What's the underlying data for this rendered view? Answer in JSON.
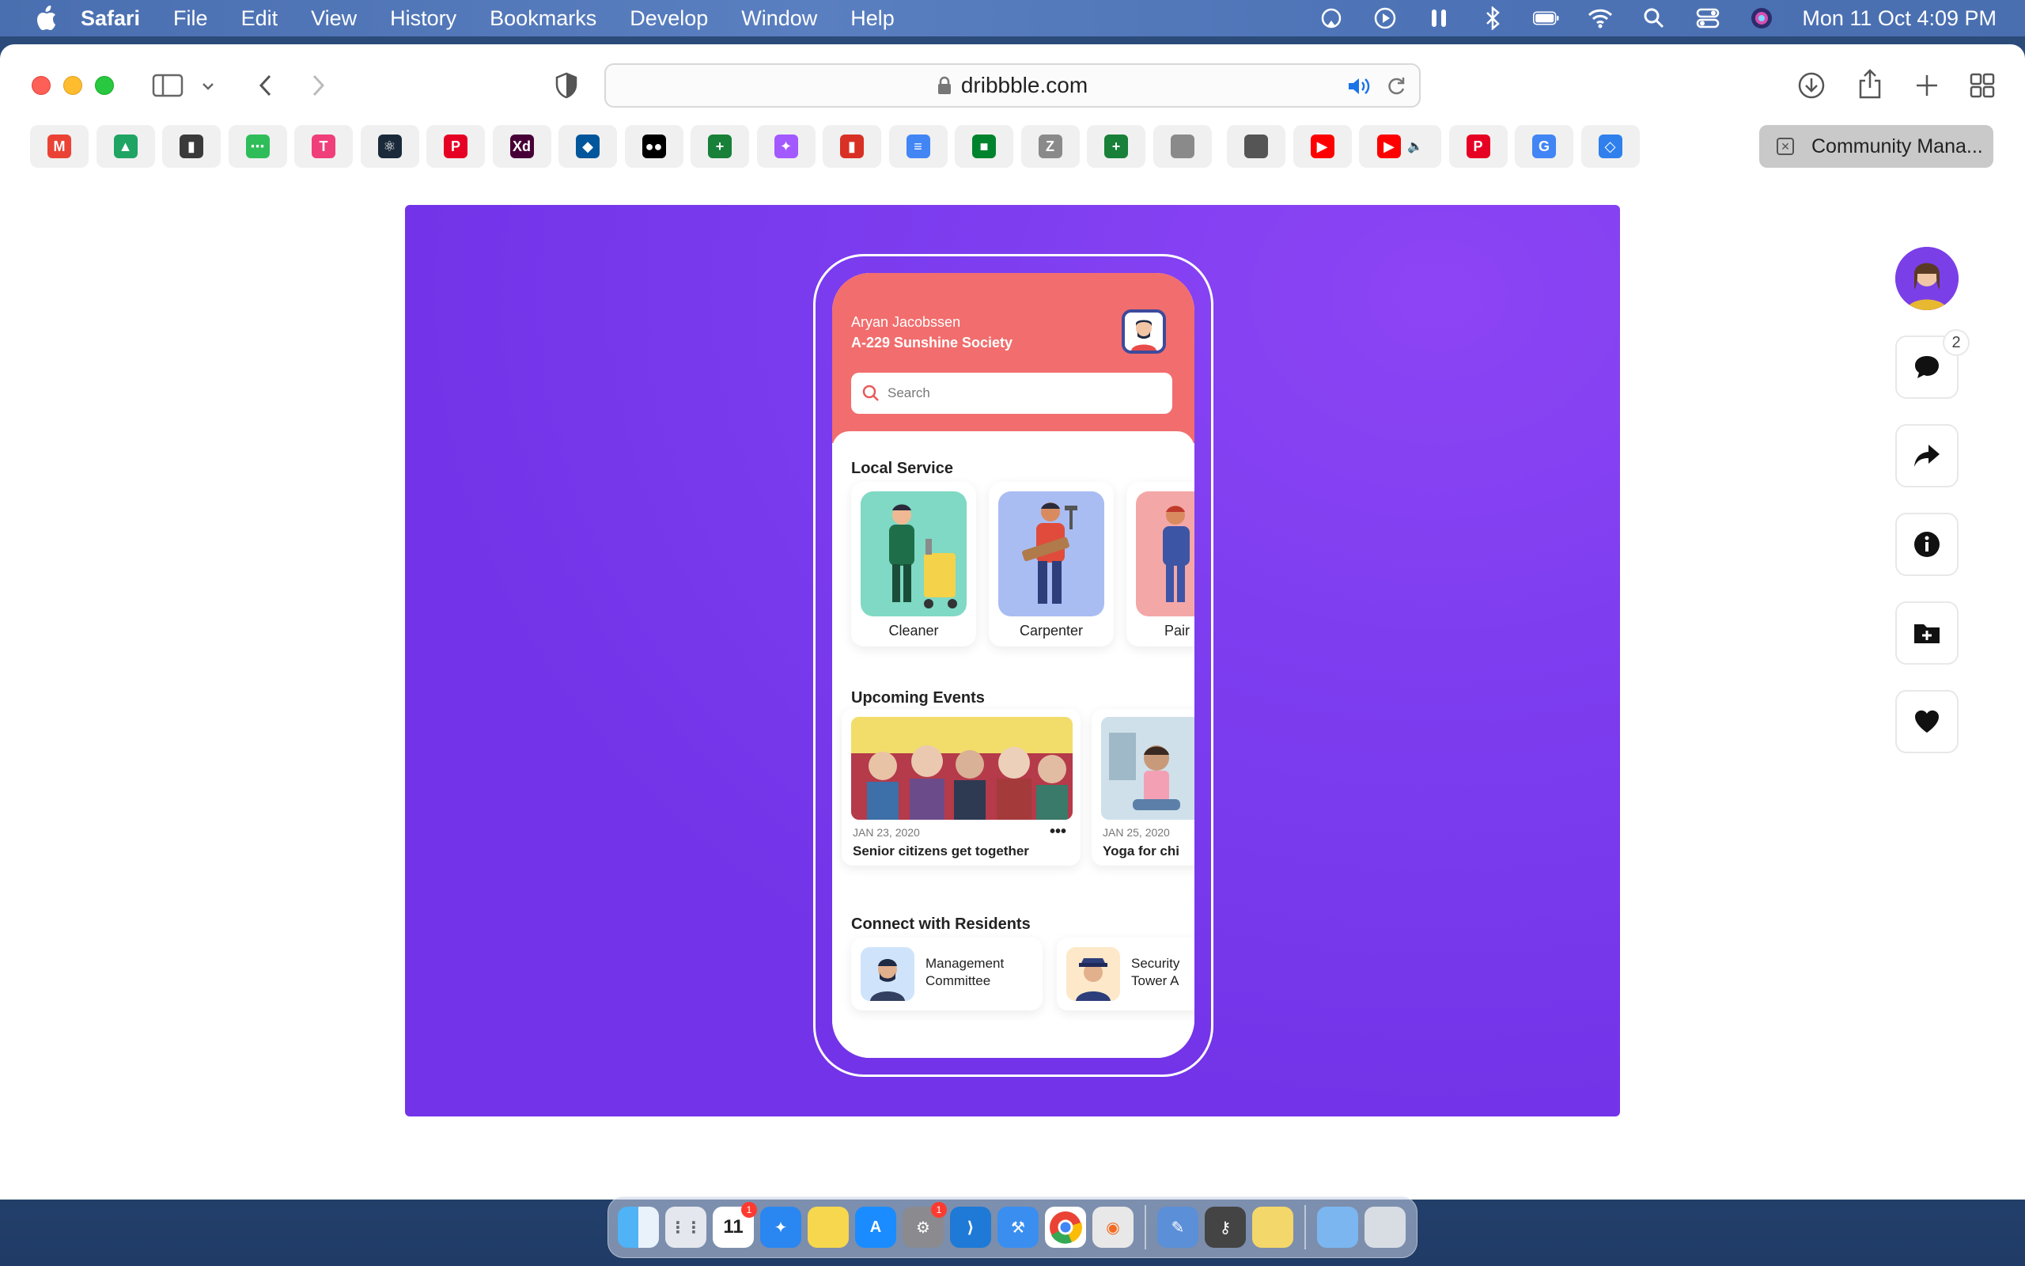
{
  "menubar": {
    "app_name": "Safari",
    "items": [
      "File",
      "Edit",
      "View",
      "History",
      "Bookmarks",
      "Develop",
      "Window",
      "Help"
    ],
    "clock": "Mon 11 Oct  4:09 PM"
  },
  "browser": {
    "url": "dribbble.com",
    "active_tab_title": "Community Mana...",
    "pinned_tabs": [
      {
        "icon": "gmail-icon",
        "glyph": "M",
        "color": "#ea4335"
      },
      {
        "icon": "google-drive-icon",
        "glyph": "▲",
        "color": "#1fa463"
      },
      {
        "icon": "sheets-icon",
        "glyph": "▮",
        "color": "#3a3a3a"
      },
      {
        "icon": "code-icon",
        "glyph": "⋯",
        "color": "#2ebd59"
      },
      {
        "icon": "t-icon",
        "glyph": "T",
        "color": "#ef3e7a"
      },
      {
        "icon": "react-icon",
        "glyph": "⚛",
        "color": "#1b2a3a"
      },
      {
        "icon": "pinterest-icon",
        "glyph": "P",
        "color": "#e60023"
      },
      {
        "icon": "adobe-xd-icon",
        "glyph": "Xd",
        "color": "#470137"
      },
      {
        "icon": "flutter-icon",
        "glyph": "◆",
        "color": "#02569b"
      },
      {
        "icon": "medium-icon",
        "glyph": "●●",
        "color": "#000000"
      },
      {
        "icon": "google-sheets-icon",
        "glyph": "+",
        "color": "#188038"
      },
      {
        "icon": "figma-icon",
        "glyph": "✦",
        "color": "#a259ff"
      },
      {
        "icon": "bar-chart-icon",
        "glyph": "▮",
        "color": "#d93025"
      },
      {
        "icon": "google-docs-icon",
        "glyph": "≡",
        "color": "#4285f4"
      },
      {
        "icon": "google-meet-icon",
        "glyph": "■",
        "color": "#00832d"
      },
      {
        "icon": "z-icon",
        "glyph": "Z",
        "color": "#8a8a8a"
      },
      {
        "icon": "google-sheets-icon-2",
        "glyph": "+",
        "color": "#188038"
      },
      {
        "icon": "apple-icon",
        "glyph": "",
        "color": "#8a8a8a"
      },
      {
        "icon": "apple-icon-2",
        "glyph": "",
        "color": "#555555"
      },
      {
        "icon": "youtube-icon",
        "glyph": "▶",
        "color": "#ff0000"
      },
      {
        "icon": "youtube-audio-icon",
        "glyph": "▶",
        "color": "#ff0000"
      },
      {
        "icon": "pinterest-icon-2",
        "glyph": "P",
        "color": "#e60023"
      },
      {
        "icon": "google-icon",
        "glyph": "G",
        "color": "#4285f4"
      },
      {
        "icon": "diamond-icon",
        "glyph": "◇",
        "color": "#2f80ed"
      }
    ]
  },
  "shot": {
    "user_name": "Aryan Jacobssen",
    "user_address": "A-229 Sunshine Society",
    "search_placeholder": "Search",
    "section_local": "Local Service",
    "services": [
      "Cleaner",
      "Carpenter",
      "Pair"
    ],
    "section_events": "Upcoming Events",
    "events": [
      {
        "date": "JAN 23, 2020",
        "title": "Senior citizens get together"
      },
      {
        "date": "JAN 25, 2020",
        "title": "Yoga for chi"
      }
    ],
    "section_residents": "Connect with Residents",
    "residents": [
      {
        "title": "Management\nCommittee"
      },
      {
        "title": "Security\nTower A"
      }
    ]
  },
  "rail": {
    "comment_count": "2"
  },
  "colors": {
    "shot_bg": "#7333e8",
    "header_coral": "#f26d6d",
    "accent_navy": "#3d4a9c"
  }
}
